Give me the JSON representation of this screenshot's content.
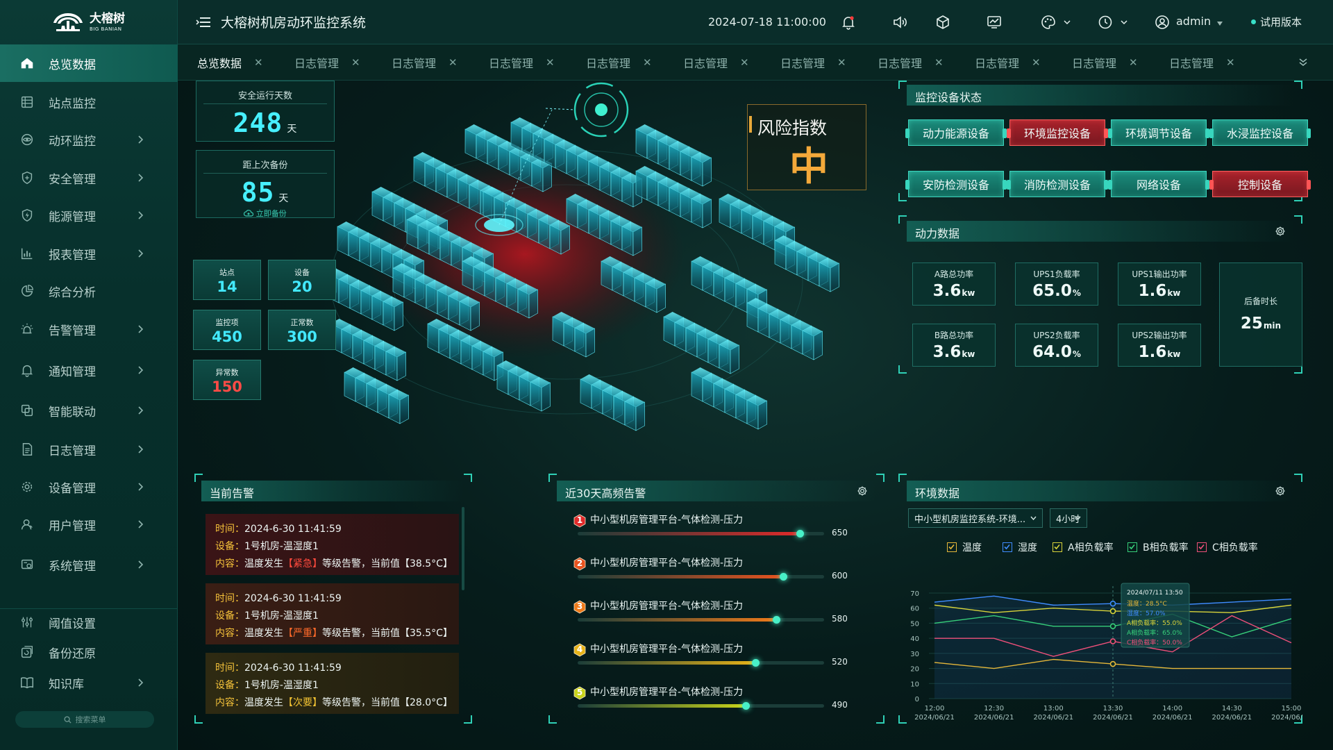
{
  "logo": {
    "name": "大榕树",
    "en": "BIG BANIAN"
  },
  "sidebar": {
    "items": [
      {
        "label": "总览数据",
        "icon": "home-icon",
        "chev": false,
        "active": true
      },
      {
        "label": "站点监控",
        "icon": "grid-list-icon",
        "chev": false
      },
      {
        "label": "动环监控",
        "icon": "eye-icon",
        "chev": true
      },
      {
        "label": "安全管理",
        "icon": "shield-icon",
        "chev": true
      },
      {
        "label": "能源管理",
        "icon": "energy-icon",
        "chev": true
      },
      {
        "label": "报表管理",
        "icon": "bar-chart-icon",
        "chev": true
      },
      {
        "label": "综合分析",
        "icon": "pie-chart-icon",
        "chev": false
      },
      {
        "label": "告警管理",
        "icon": "alarm-light-icon",
        "chev": true
      },
      {
        "label": "通知管理",
        "icon": "bell-icon",
        "chev": true
      },
      {
        "label": "智能联动",
        "icon": "link-icon",
        "chev": true
      },
      {
        "label": "日志管理",
        "icon": "document-icon",
        "chev": true
      },
      {
        "label": "设备管理",
        "icon": "device-gear-icon",
        "chev": true
      },
      {
        "label": "用户管理",
        "icon": "user-icon",
        "chev": true
      },
      {
        "label": "系统管理",
        "icon": "system-icon",
        "chev": true
      }
    ],
    "bottom": [
      {
        "label": "阈值设置",
        "icon": "sliders-icon",
        "chev": false
      },
      {
        "label": "备份还原",
        "icon": "backup-icon",
        "chev": false
      },
      {
        "label": "知识库",
        "icon": "book-icon",
        "chev": true
      }
    ],
    "search_label": "搜索菜单"
  },
  "topbar": {
    "title": "大榕树机房动环监控系统",
    "datetime": "2024-07-18 11:00:00",
    "user": "admin",
    "trial": "试用版本"
  },
  "tabs": [
    "总览数据",
    "日志管理",
    "日志管理",
    "日志管理",
    "日志管理",
    "日志管理",
    "日志管理",
    "日志管理",
    "日志管理",
    "日志管理",
    "日志管理"
  ],
  "stats": {
    "safe_days": {
      "label": "安全运行天数",
      "value": "248",
      "unit": "天"
    },
    "backup": {
      "label": "距上次备份",
      "value": "85",
      "unit": "天",
      "action": "立即备份"
    },
    "small": [
      {
        "label": "站点",
        "value": "14"
      },
      {
        "label": "设备",
        "value": "20"
      },
      {
        "label": "监控项",
        "value": "450"
      },
      {
        "label": "正常数",
        "value": "300"
      },
      {
        "label": "异常数",
        "value": "150"
      }
    ]
  },
  "risk": {
    "title": "风险指数",
    "level": "中"
  },
  "device_status": {
    "title": "监控设备状态",
    "items": [
      {
        "label": "动力能源设备",
        "ok": true
      },
      {
        "label": "环境监控设备",
        "ok": false
      },
      {
        "label": "环境调节设备",
        "ok": true
      },
      {
        "label": "水浸监控设备",
        "ok": true
      },
      {
        "label": "安防检测设备",
        "ok": true
      },
      {
        "label": "消防检测设备",
        "ok": true
      },
      {
        "label": "网络设备",
        "ok": true
      },
      {
        "label": "控制设备",
        "ok": false
      }
    ]
  },
  "power": {
    "title": "动力数据",
    "cards": [
      {
        "label": "A路总功率",
        "value": "3.6",
        "unit": "kw"
      },
      {
        "label": "UPS1负载率",
        "value": "65.0",
        "unit": "%"
      },
      {
        "label": "UPS1输出功率",
        "value": "1.6",
        "unit": "kw"
      },
      {
        "label": "B路总功率",
        "value": "3.6",
        "unit": "kw"
      },
      {
        "label": "UPS2负载率",
        "value": "64.0",
        "unit": "%"
      },
      {
        "label": "UPS2输出功率",
        "value": "1.6",
        "unit": "kw"
      }
    ],
    "backup": {
      "label": "后备时长",
      "value": "25",
      "unit": "min"
    }
  },
  "alerts": {
    "title": "当前告警",
    "labels": {
      "time": "时间：",
      "device": "设备：",
      "content": "内容："
    },
    "items": [
      {
        "time": "2024-6-30  11:41:59",
        "device": "1号机房-温湿度1",
        "pre": "温度发生",
        "level": "【紧急】",
        "post": "等级告警，当前值【38.5°C】",
        "sev": "r"
      },
      {
        "time": "2024-6-30  11:41:59",
        "device": "1号机房-温湿度1",
        "pre": "温度发生",
        "level": "【严重】",
        "post": "等级告警，当前值【35.5°C】",
        "sev": "o"
      },
      {
        "time": "2024-6-30  11:41:59",
        "device": "1号机房-温湿度1",
        "pre": "温度发生",
        "level": "【次要】",
        "post": "等级告警，当前值【28.0°C】",
        "sev": "y"
      }
    ]
  },
  "top_alarms": {
    "title": "近30天高频告警",
    "max": 720,
    "items": [
      {
        "rank": "1",
        "name": "中小型机房管理平台-气体检测-压力",
        "value": 650,
        "color": "#e02a2a"
      },
      {
        "rank": "2",
        "name": "中小型机房管理平台-气体检测-压力",
        "value": 600,
        "color": "#e8531f"
      },
      {
        "rank": "3",
        "name": "中小型机房管理平台-气体检测-压力",
        "value": 580,
        "color": "#ef7a1a"
      },
      {
        "rank": "4",
        "name": "中小型机房管理平台-气体检测-压力",
        "value": 520,
        "color": "#e8b318"
      },
      {
        "rank": "5",
        "name": "中小型机房管理平台-气体检测-压力",
        "value": 490,
        "color": "#c9d41a"
      }
    ]
  },
  "env": {
    "title": "环境数据",
    "select1": "中小型机房监控系统-环境...",
    "select2": "4小时",
    "legend": [
      {
        "name": "温度",
        "color": "#e6b83a"
      },
      {
        "name": "湿度",
        "color": "#3f8cff"
      },
      {
        "name": "A相负载率",
        "color": "#d9d43a"
      },
      {
        "name": "B相负载率",
        "color": "#37d07a"
      },
      {
        "name": "C相负载率",
        "color": "#f0507a"
      }
    ],
    "tooltip": {
      "time": "2024/07/11 13:50",
      "rows": [
        {
          "k": "温度：",
          "v": "28.5°C",
          "color": "#e6b83a"
        },
        {
          "k": "湿度：",
          "v": "57.0%",
          "color": "#3f8cff"
        },
        {
          "k": "A相负载率：",
          "v": "55.0%",
          "color": "#d9d43a"
        },
        {
          "k": "A相负载率：",
          "v": "65.0%",
          "color": "#37d07a"
        },
        {
          "k": "C相负载率：",
          "v": "50.0%",
          "color": "#f0507a"
        }
      ]
    }
  },
  "chart_data": {
    "type": "line",
    "x": [
      "12:00",
      "12:30",
      "13:00",
      "13:30",
      "14:00",
      "14:30",
      "15:00"
    ],
    "x_dates": [
      "2024/06/21",
      "2024/06/21",
      "2024/06/21",
      "2024/06/21",
      "2024/06/21",
      "2024/06/21",
      "2024/06/21"
    ],
    "ylim": [
      0,
      70
    ],
    "yticks": [
      0,
      10,
      20,
      30,
      40,
      50,
      60,
      70
    ],
    "series": [
      {
        "name": "温度",
        "color": "#e6b83a",
        "values": [
          24,
          20,
          26,
          23,
          20,
          20,
          20
        ]
      },
      {
        "name": "湿度",
        "color": "#3f8cff",
        "values": [
          64,
          68,
          62,
          63,
          62,
          64,
          66
        ]
      },
      {
        "name": "A相负载率",
        "color": "#d9d43a",
        "values": [
          62,
          57,
          60,
          58,
          58,
          57,
          62
        ]
      },
      {
        "name": "B相负载率",
        "color": "#37d07a",
        "values": [
          50,
          55,
          48,
          48,
          56,
          41,
          53
        ]
      },
      {
        "name": "C相负载率",
        "color": "#f0507a",
        "values": [
          40,
          40,
          28,
          38,
          31,
          55,
          37
        ]
      }
    ]
  }
}
